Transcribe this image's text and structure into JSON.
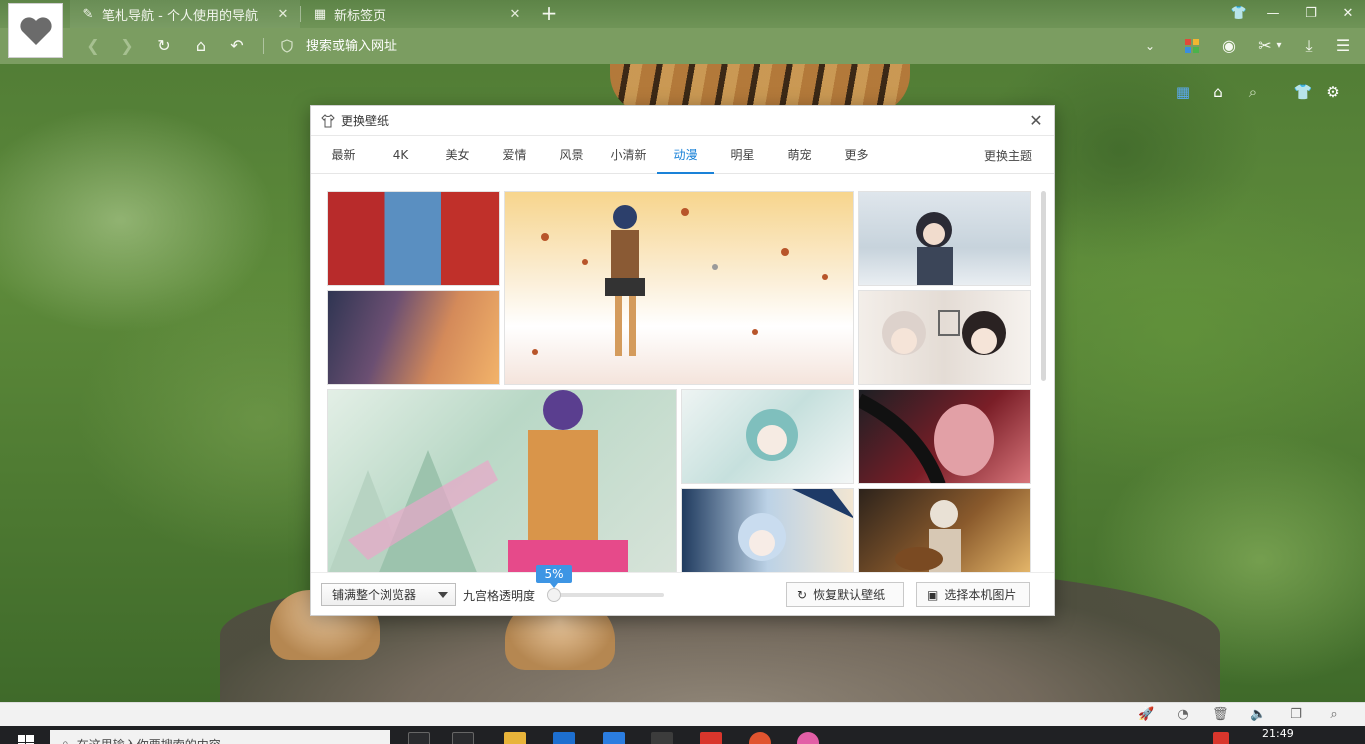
{
  "browser": {
    "tabs": [
      {
        "title": "笔札导航 - 个人使用的导航",
        "active": true
      },
      {
        "title": "新标签页",
        "active": false
      }
    ],
    "address_placeholder": "搜索或输入网址"
  },
  "dialog": {
    "title": "更换壁纸",
    "categories": [
      "最新",
      "4K",
      "美女",
      "爱情",
      "风景",
      "小清新",
      "动漫",
      "明星",
      "萌宠",
      "更多"
    ],
    "active_category": "动漫",
    "change_theme": "更换主题",
    "fill_mode": "铺满整个浏览器",
    "opacity_label": "九宫格透明度",
    "opacity_value_text": "5%",
    "opacity_fraction": 0.05,
    "restore_button": "恢复默认壁纸",
    "local_button": "选择本机图片"
  },
  "taskbar": {
    "search_placeholder": "在这里输入你要搜索的内容",
    "time": "21:49"
  },
  "colors": {
    "accent": "#1a82d8",
    "tooltip": "#3d95e4",
    "toolbar": "#7b9d61"
  }
}
